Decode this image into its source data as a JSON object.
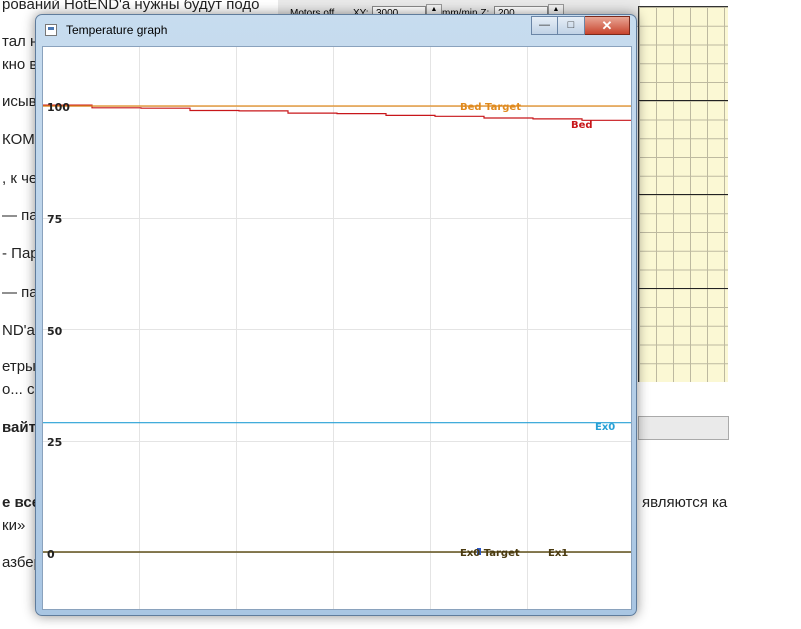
{
  "background": {
    "article_lines": [
      "рований HotEND'а нужны будут подо",
      "тал н",
      "кно ви",
      "исыв",
      "КОМ",
      ", к че",
      "— па",
      "- Пар",
      "— па",
      "ND'a п",
      "етры",
      "о... со",
      "вайте",
      "е всег",
      "ки»",
      "азбер"
    ],
    "right_fragment": "являются ка",
    "toolbar": {
      "motors_label": "Motors off",
      "xy_label": "XY:",
      "xy_value": "3000",
      "z_label": "mm/min Z:",
      "z_value": "200"
    }
  },
  "window": {
    "title": "Temperature graph",
    "controls": {
      "minimize": "—",
      "maximize": "□",
      "close": "✕"
    }
  },
  "colors": {
    "bed": "#c8161a",
    "bed_target": "#e08a1e",
    "ex0": "#27a0d6",
    "ex0_target_marker": "#2a57c8",
    "baseline": "#5a4a10",
    "grid": "#e4e4e4"
  },
  "chart_data": {
    "type": "line",
    "title": "",
    "xlabel": "",
    "ylabel": "",
    "ylim": [
      0,
      110
    ],
    "yticks": [
      "100",
      "75",
      "50",
      "25",
      "0"
    ],
    "x": [
      0,
      5,
      10,
      15,
      20,
      25,
      30,
      35,
      40,
      45,
      50,
      55,
      60
    ],
    "series": [
      {
        "name": "Bed",
        "values": [
          100.2,
          99.6,
          99.5,
          99.0,
          98.9,
          98.4,
          98.3,
          97.9,
          97.7,
          97.3,
          97.1,
          96.8,
          96.8
        ]
      },
      {
        "name": "Bed Target",
        "values": [
          100,
          100,
          100,
          100,
          100,
          100,
          100,
          100,
          100,
          100,
          100,
          100,
          100
        ]
      },
      {
        "name": "Ex0",
        "values": [
          29,
          29,
          29,
          29,
          29,
          29,
          29,
          29,
          29,
          29,
          29,
          29,
          29
        ]
      },
      {
        "name": "Ex0 Target",
        "values": [
          0,
          0,
          0,
          0,
          0,
          0,
          0,
          0,
          0,
          0,
          0,
          0,
          0
        ]
      },
      {
        "name": "Ex1",
        "values": [
          0,
          0,
          0,
          0,
          0,
          0,
          0,
          0,
          0,
          0,
          0,
          0,
          0
        ]
      }
    ]
  }
}
